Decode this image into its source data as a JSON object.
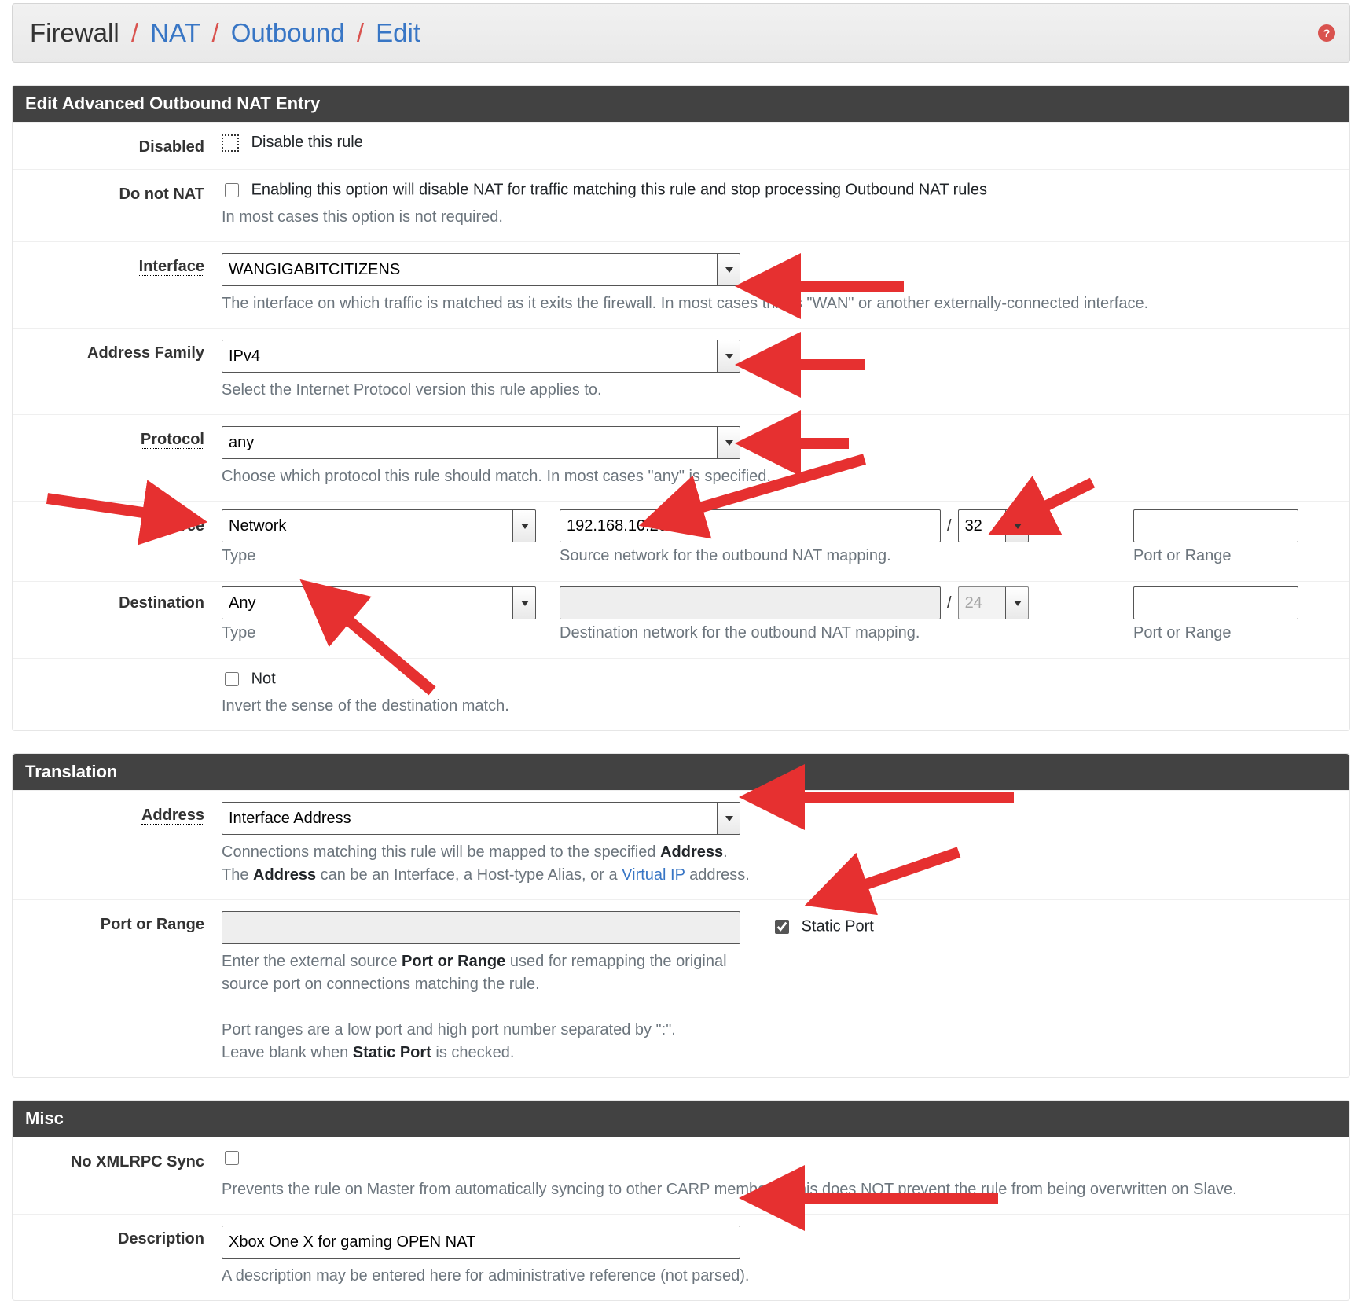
{
  "breadcrumb": {
    "first": "Firewall",
    "links": [
      "NAT",
      "Outbound",
      "Edit"
    ]
  },
  "panels": {
    "edit": {
      "title": "Edit Advanced Outbound NAT Entry",
      "disabled": {
        "label": "Disabled",
        "text": "Disable this rule"
      },
      "donotnat": {
        "label": "Do not NAT",
        "text": "Enabling this option will disable NAT for traffic matching this rule and stop processing Outbound NAT rules",
        "help": "In most cases this option is not required."
      },
      "interface": {
        "label": "Interface",
        "value": "WANGIGABITCITIZENS",
        "help": "The interface on which traffic is matched as it exits the firewall. In most cases this is \"WAN\" or another externally-connected interface."
      },
      "af": {
        "label": "Address Family",
        "value": "IPv4",
        "help": "Select the Internet Protocol version this rule applies to."
      },
      "protocol": {
        "label": "Protocol",
        "value": "any",
        "help": "Choose which protocol this rule should match. In most cases \"any\" is specified."
      },
      "source": {
        "label": "Source",
        "type": "Network",
        "net": "192.168.10.20",
        "cidr": "32",
        "subType": "Type",
        "subNet": "Source network for the outbound NAT mapping.",
        "subPort": "Port or Range"
      },
      "dest": {
        "label": "Destination",
        "type": "Any",
        "net": "",
        "cidr": "24",
        "subType": "Type",
        "subNet": "Destination network for the outbound NAT mapping.",
        "subPort": "Port or Range"
      },
      "not": {
        "label": "Not",
        "help": "Invert the sense of the destination match."
      }
    },
    "translation": {
      "title": "Translation",
      "address": {
        "label": "Address",
        "value": "Interface Address",
        "help1": "Connections matching this rule will be mapped to the specified ",
        "help1b": "Address",
        "help2a": "The ",
        "help2b": "Address",
        "help2c": " can be an Interface, a Host-type Alias, or a ",
        "help2link": "Virtual IP",
        "help2d": " address."
      },
      "port": {
        "label": "Port or Range",
        "static": "Static Port",
        "help1a": "Enter the external source ",
        "help1b": "Port or Range",
        "help1c": " used for remapping the original source port on connections matching the rule.",
        "help2": "Port ranges are a low port and high port number separated by \":\".",
        "help3a": "Leave blank when ",
        "help3b": "Static Port",
        "help3c": " is checked."
      }
    },
    "misc": {
      "title": "Misc",
      "noxmlrpc": {
        "label": "No XMLRPC Sync",
        "help": "Prevents the rule on Master from automatically syncing to other CARP members. This does NOT prevent the rule from being overwritten on Slave."
      },
      "description": {
        "label": "Description",
        "value": "Xbox One X for gaming OPEN NAT",
        "help": "A description may be entered here for administrative reference (not parsed)."
      }
    }
  }
}
